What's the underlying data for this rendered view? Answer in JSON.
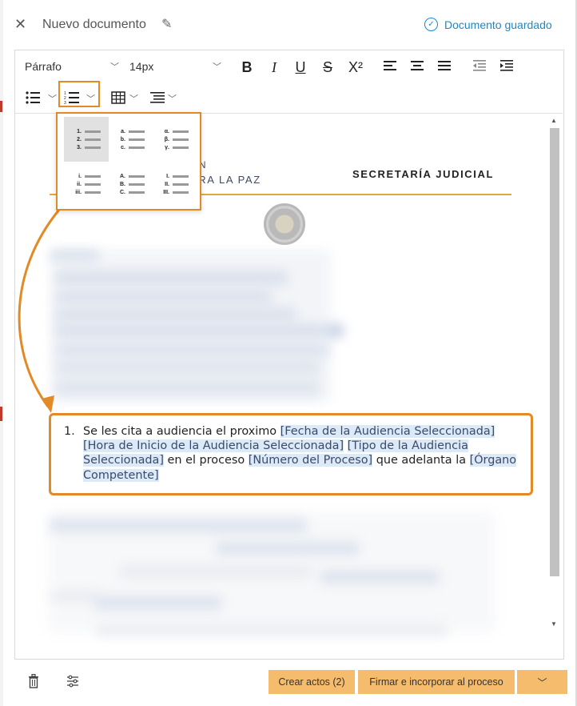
{
  "header": {
    "title": "Nuevo documento",
    "saved_status": "Documento guardado"
  },
  "toolbar": {
    "paragraph_style": "Párrafo",
    "font_size": "14px",
    "bold": "B",
    "italic": "I",
    "underline": "U",
    "strike": "S",
    "superscript": "X²"
  },
  "numbering_menu": {
    "options": [
      {
        "markers": [
          "1.",
          "2.",
          "3."
        ]
      },
      {
        "markers": [
          "a.",
          "b.",
          "c."
        ]
      },
      {
        "markers": [
          "α.",
          "β.",
          "γ."
        ]
      },
      {
        "markers": [
          "i.",
          "ii.",
          "iii."
        ]
      },
      {
        "markers": [
          "A.",
          "B.",
          "C."
        ]
      },
      {
        "markers": [
          "I.",
          "II.",
          "III."
        ]
      }
    ]
  },
  "letterhead": {
    "org_line_1": "ÓN",
    "org_line_2": "ARA LA PAZ",
    "department": "SECRETARÍA JUDICIAL"
  },
  "list_item": {
    "number": "1.",
    "t1": "Se les cita a audiencia el proximo ",
    "f1": "[Fecha de la Audiencia Seleccionada]",
    "s1": " ",
    "f2": "[Hora de Inicio de la Audiencia Seleccionada]",
    "s2": " ",
    "f3": "[Tipo de la Audiencia Seleccionada]",
    "t2": " en el proceso ",
    "f4": "[Número del Proceso]",
    "t3": " que adelanta la ",
    "f5": "[Órgano Competente]"
  },
  "footer": {
    "create_acts": "Crear actos (2)",
    "sign_and_add": "Firmar e incorporar al proceso"
  },
  "colors": {
    "accent_blue": "#1e88c7",
    "highlight_orange": "#e28a25",
    "button_orange": "#f6bc6e",
    "field_highlight": "#dce9f7"
  }
}
